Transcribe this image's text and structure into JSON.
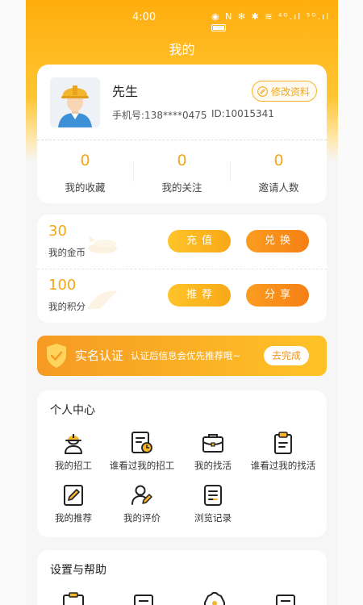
{
  "status_bar": {
    "time": "4:00",
    "icons": "◉ N ✻ ✱ ≋ ⁴ᴳ.ıl ⁵ᴳ.ıl"
  },
  "page_title": "我的",
  "profile": {
    "name": "先生",
    "phone_label": "手机号:138****0475",
    "id_label": "ID:10015341",
    "edit_label": "修改资料"
  },
  "stats": [
    {
      "value": "0",
      "label": "我的收藏"
    },
    {
      "value": "0",
      "label": "我的关注"
    },
    {
      "value": "0",
      "label": "邀请人数"
    }
  ],
  "wallet": {
    "coins": {
      "value": "30",
      "label": "我的金币",
      "btn1": "充值",
      "btn2": "兑换"
    },
    "points": {
      "value": "100",
      "label": "我的积分",
      "btn1": "推荐",
      "btn2": "分享"
    }
  },
  "verify": {
    "title": "实名认证",
    "desc": "认证后信息会优先推荐哦~",
    "button": "去完成"
  },
  "personal_center": {
    "title": "个人中心",
    "items": [
      {
        "label": "我的招工",
        "icon": "worker-icon"
      },
      {
        "label": "谁看过我的招工",
        "icon": "viewed-list-icon"
      },
      {
        "label": "我的找活",
        "icon": "briefcase-icon"
      },
      {
        "label": "谁看过我的找活",
        "icon": "clipboard-icon"
      },
      {
        "label": "我的推荐",
        "icon": "edit-doc-icon"
      },
      {
        "label": "我的评价",
        "icon": "user-review-icon"
      },
      {
        "label": "浏览记录",
        "icon": "history-doc-icon"
      }
    ]
  },
  "settings_help": {
    "title": "设置与帮助"
  },
  "colors": {
    "accent": "#f0a81b",
    "header": "#ffad0d",
    "orange_btn": "#f57f14"
  }
}
